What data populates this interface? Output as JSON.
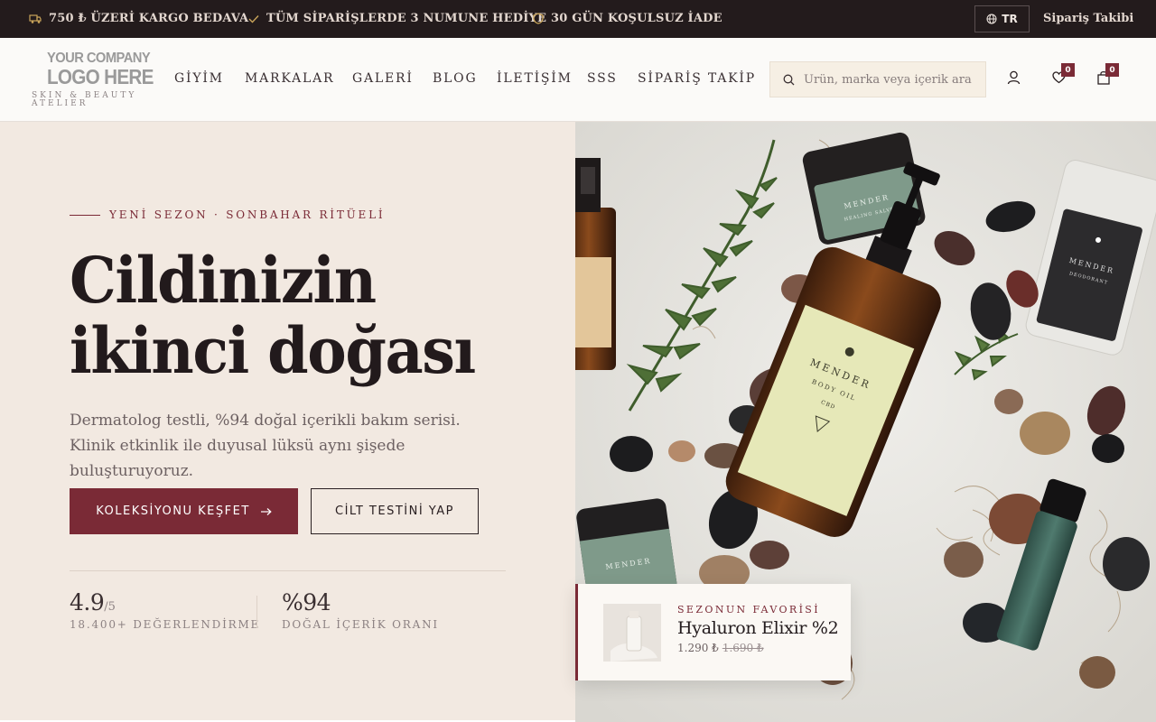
{
  "topbar": {
    "promos": [
      {
        "icon": "truck-icon",
        "text": "750 ₺ ÜZERİ KARGO BEDAVA"
      },
      {
        "icon": "check-icon",
        "text": "TÜM SİPARİŞLERDE 3 NUMUNE HEDİYE"
      },
      {
        "icon": "shield-icon",
        "text": "30 GÜN KOŞULSUZ İADE"
      }
    ],
    "language": "TR",
    "order_tracking": "Sipariş Takibi"
  },
  "header": {
    "logo_line1": "YOUR COMPANY",
    "logo_line2": "LOGO HERE",
    "tagline": "SKIN & BEAUTY ATELIER",
    "nav": [
      "GİYİM",
      "MARKALAR",
      "GALERİ",
      "BLOG",
      "İLETİŞİM",
      "SSS",
      "SİPARİŞ TAKİP"
    ],
    "search_placeholder": "Ürün, marka veya içerik ara",
    "wishlist_count": "0",
    "cart_count": "0"
  },
  "hero": {
    "eyebrow": "YENİ SEZON · SONBAHAR RİTÜELİ",
    "headline_line1": "Cildinizin",
    "headline_line2": "ikinci doğası",
    "lead": "Dermatolog testli, %94 doğal içerikli bakım serisi. Klinik etkinlik ile duyusal lüksü aynı şişede buluşturuyoruz.",
    "primary_cta": "KOLEKSİYONU KEŞFET",
    "secondary_cta": "CİLT TESTİNİ YAP",
    "stats": [
      {
        "value": "4.9",
        "suffix": "/5",
        "label": "18.400+ DEĞERLENDİRME"
      },
      {
        "value": "%94",
        "suffix": "",
        "label": "DOĞAL İÇERİK ORANI"
      }
    ]
  },
  "favorite": {
    "kicker": "SEZONUN FAVORİSİ",
    "title": "Hyaluron Elixir %2",
    "price": "1.290 ₺",
    "old_price": "1.690 ₺"
  },
  "colors": {
    "accent": "#7a2a36",
    "topbar_bg": "#231b1c",
    "hero_bg": "#f2e9e1",
    "gold": "#c9a45a"
  }
}
